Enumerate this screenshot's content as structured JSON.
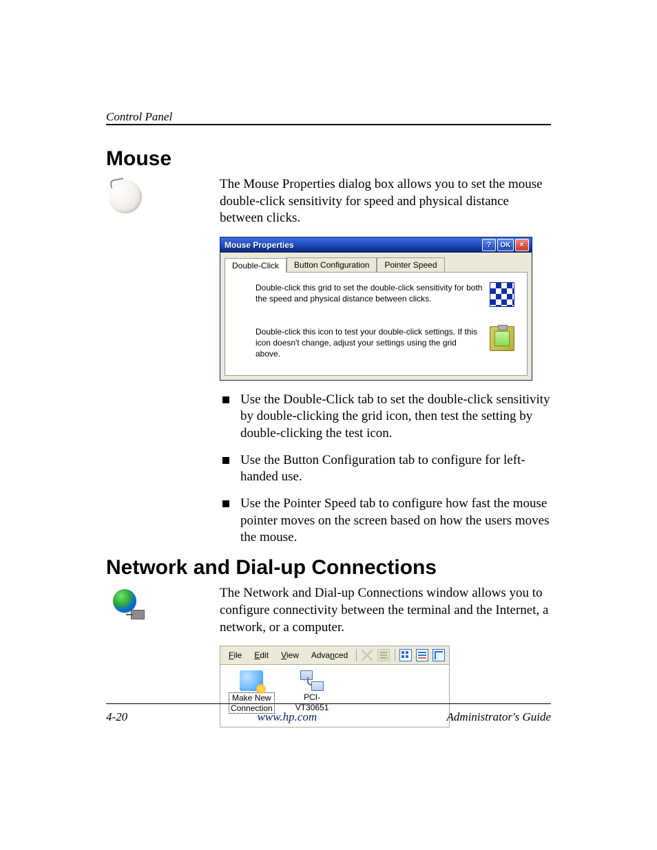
{
  "header": {
    "running_head": "Control Panel"
  },
  "section1": {
    "title": "Mouse",
    "intro": "The Mouse Properties dialog box allows you to set the mouse double-click sensitivity for speed and physical distance between clicks.",
    "bullets": [
      "Use the Double-Click tab to set the double-click sensitivity by double-clicking the grid icon, then test the setting by double-clicking the test icon.",
      "Use the Button Configuration tab to configure for left-handed use.",
      "Use the Pointer Speed tab to configure how fast the mouse pointer moves on the screen based on how the users moves the mouse."
    ]
  },
  "dialog": {
    "title": "Mouse Properties",
    "help_label": "?",
    "ok_label": "OK",
    "close_label": "×",
    "tabs": {
      "double_click": "Double-Click",
      "button_config": "Button Configuration",
      "pointer_speed": "Pointer Speed"
    },
    "row1": "Double-click this grid to set the double-click sensitivity for both the speed and physical distance between clicks.",
    "row2": "Double-click this icon to test your double-click settings. If this icon doesn't change, adjust your settings using the grid above."
  },
  "section2": {
    "title": "Network and Dial-up Connections",
    "intro": "The Network and Dial-up Connections window allows you to configure connectivity between the terminal and the Internet, a network, or a computer."
  },
  "net": {
    "menu": {
      "file": "File",
      "edit": "Edit",
      "view": "View",
      "advanced": "Advanced"
    },
    "items": {
      "make_new_1": "Make New",
      "make_new_2": "Connection",
      "pci_1": "PCI-",
      "pci_2": "VT30651"
    }
  },
  "footer": {
    "page": "4-20",
    "url": "www.hp.com",
    "guide": "Administrator's Guide"
  }
}
